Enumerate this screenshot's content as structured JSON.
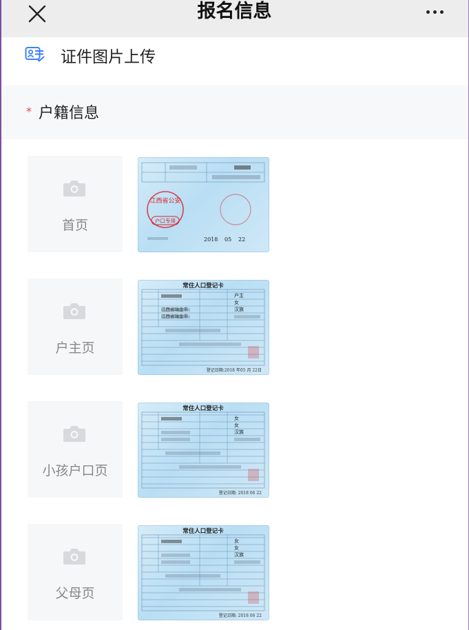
{
  "header": {
    "title": "报名信息",
    "close_icon": "close-icon",
    "more_icon": "more-icon"
  },
  "section": {
    "icon": "id-card-icon",
    "title": "证件图片上传"
  },
  "group": {
    "required_mark": "*",
    "title": "户籍信息"
  },
  "uploads": [
    {
      "label": "首页",
      "thumbnail": {
        "kind": "household-register-cover",
        "seal_left": "户口专用",
        "seal_top": "江西省公安",
        "year": "2018",
        "month": "05",
        "day": "22"
      }
    },
    {
      "label": "户主页",
      "thumbnail": {
        "kind": "resident-registration-card",
        "card_title": "常住人口登记卡",
        "relation": "户主",
        "gender": "女",
        "ethnicity": "汉族",
        "place1": "江西省瑞金市",
        "place2": "江西省瑞金市",
        "date_text": "登记日期:2018 年05 月 22日"
      }
    },
    {
      "label": "小孩户口页",
      "thumbnail": {
        "kind": "resident-registration-card",
        "card_title": "常住人口登记卡",
        "relation": "女",
        "gender": "女",
        "ethnicity": "汉族",
        "date_text": "登记日期: 2018 06 22"
      }
    },
    {
      "label": "父母页",
      "thumbnail": {
        "kind": "resident-registration-card",
        "card_title": "常住人口登记卡",
        "relation": "女",
        "gender": "女",
        "ethnicity": "汉族",
        "date_text": "登记日期: 2018 06 22"
      }
    }
  ],
  "colors": {
    "topbar_bg": "#ededed",
    "accent_blue": "#3d7eff",
    "required_red": "#e5484d",
    "placeholder_bg": "#f6f7f8",
    "seal_red": "#d8262e"
  }
}
